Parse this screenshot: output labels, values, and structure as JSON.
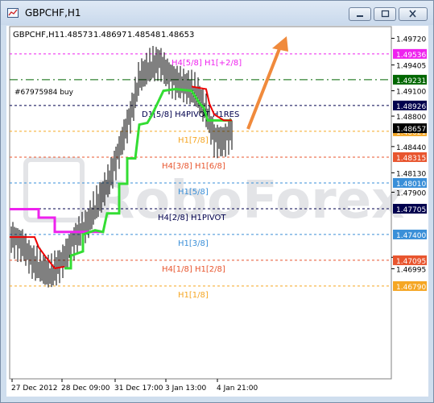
{
  "window": {
    "title": "GBPCHF,H1",
    "minimize_glyph": "–",
    "maximize_glyph": "□",
    "close_glyph": "×"
  },
  "chart_header": {
    "symbol": "GBPCHF,H1",
    "open": "1.48573",
    "high": "1.48697",
    "low": "1.48548",
    "close": "1.48653"
  },
  "order_label": "#67975984 buy",
  "watermark": "RoboForex",
  "price_axis": [
    "1.49720",
    "1.49405",
    "1.49100",
    "1.48800",
    "1.48440",
    "1.48130",
    "1.47900",
    "1.47130",
    "1.46995"
  ],
  "time_axis": [
    "27 Dec 2012",
    "28 Dec 09:00",
    "31 Dec 17:00",
    "3 Jan 13:00",
    "4 Jan 21:00"
  ],
  "levels": [
    {
      "label": "H4[5/8] H1[+2/8]",
      "price_tag": "1.49536",
      "color": "#ee22ee",
      "tag_bg": "#ee22ee",
      "tag_fg": "#ffffff"
    },
    {
      "label": "",
      "price_tag": "1.49231",
      "color": "#006600",
      "tag_bg": "#006600",
      "tag_fg": "#ffffff"
    },
    {
      "label": "D1[5/8] H4PIVOT H1RES",
      "price_tag": "1.48926",
      "color": "#00004d",
      "tag_bg": "#00004d",
      "tag_fg": "#ffffff"
    },
    {
      "label": "H1[7/8]",
      "price_tag": "1.48621",
      "color": "#f5a623",
      "tag_bg": "#f5a623",
      "tag_fg": "#ffffff"
    },
    {
      "label": "H4[3/8] H1[6/8]",
      "price_tag": "1.48315",
      "color": "#e8552e",
      "tag_bg": "#e8552e",
      "tag_fg": "#ffffff"
    },
    {
      "label": "H1[5/8]",
      "price_tag": "1.48010",
      "color": "#3a8fd8",
      "tag_bg": "#3a8fd8",
      "tag_fg": "#ffffff"
    },
    {
      "label": "H4[2/8] H1PIVOT",
      "price_tag": "1.47705",
      "color": "#00004d",
      "tag_bg": "#00004d",
      "tag_fg": "#ffffff"
    },
    {
      "label": "H1[3/8]",
      "price_tag": "1.47400",
      "color": "#3a8fd8",
      "tag_bg": "#3a8fd8",
      "tag_fg": "#ffffff"
    },
    {
      "label": "H4[1/8] H1[2/8]",
      "price_tag": "1.47095",
      "color": "#e8552e",
      "tag_bg": "#e8552e",
      "tag_fg": "#ffffff"
    },
    {
      "label": "H1[1/8]",
      "price_tag": "1.46790",
      "color": "#f5a623",
      "tag_bg": "#f5a623",
      "tag_fg": "#ffffff"
    }
  ],
  "colors": {
    "arrow": "#f08a3c",
    "green_line": "#33dd33",
    "red_line": "#ee0000",
    "magenta_line": "#ee22ee",
    "candles": "#000000",
    "current_price_tag": "#000000"
  },
  "current_price_tag": "1.48657"
}
